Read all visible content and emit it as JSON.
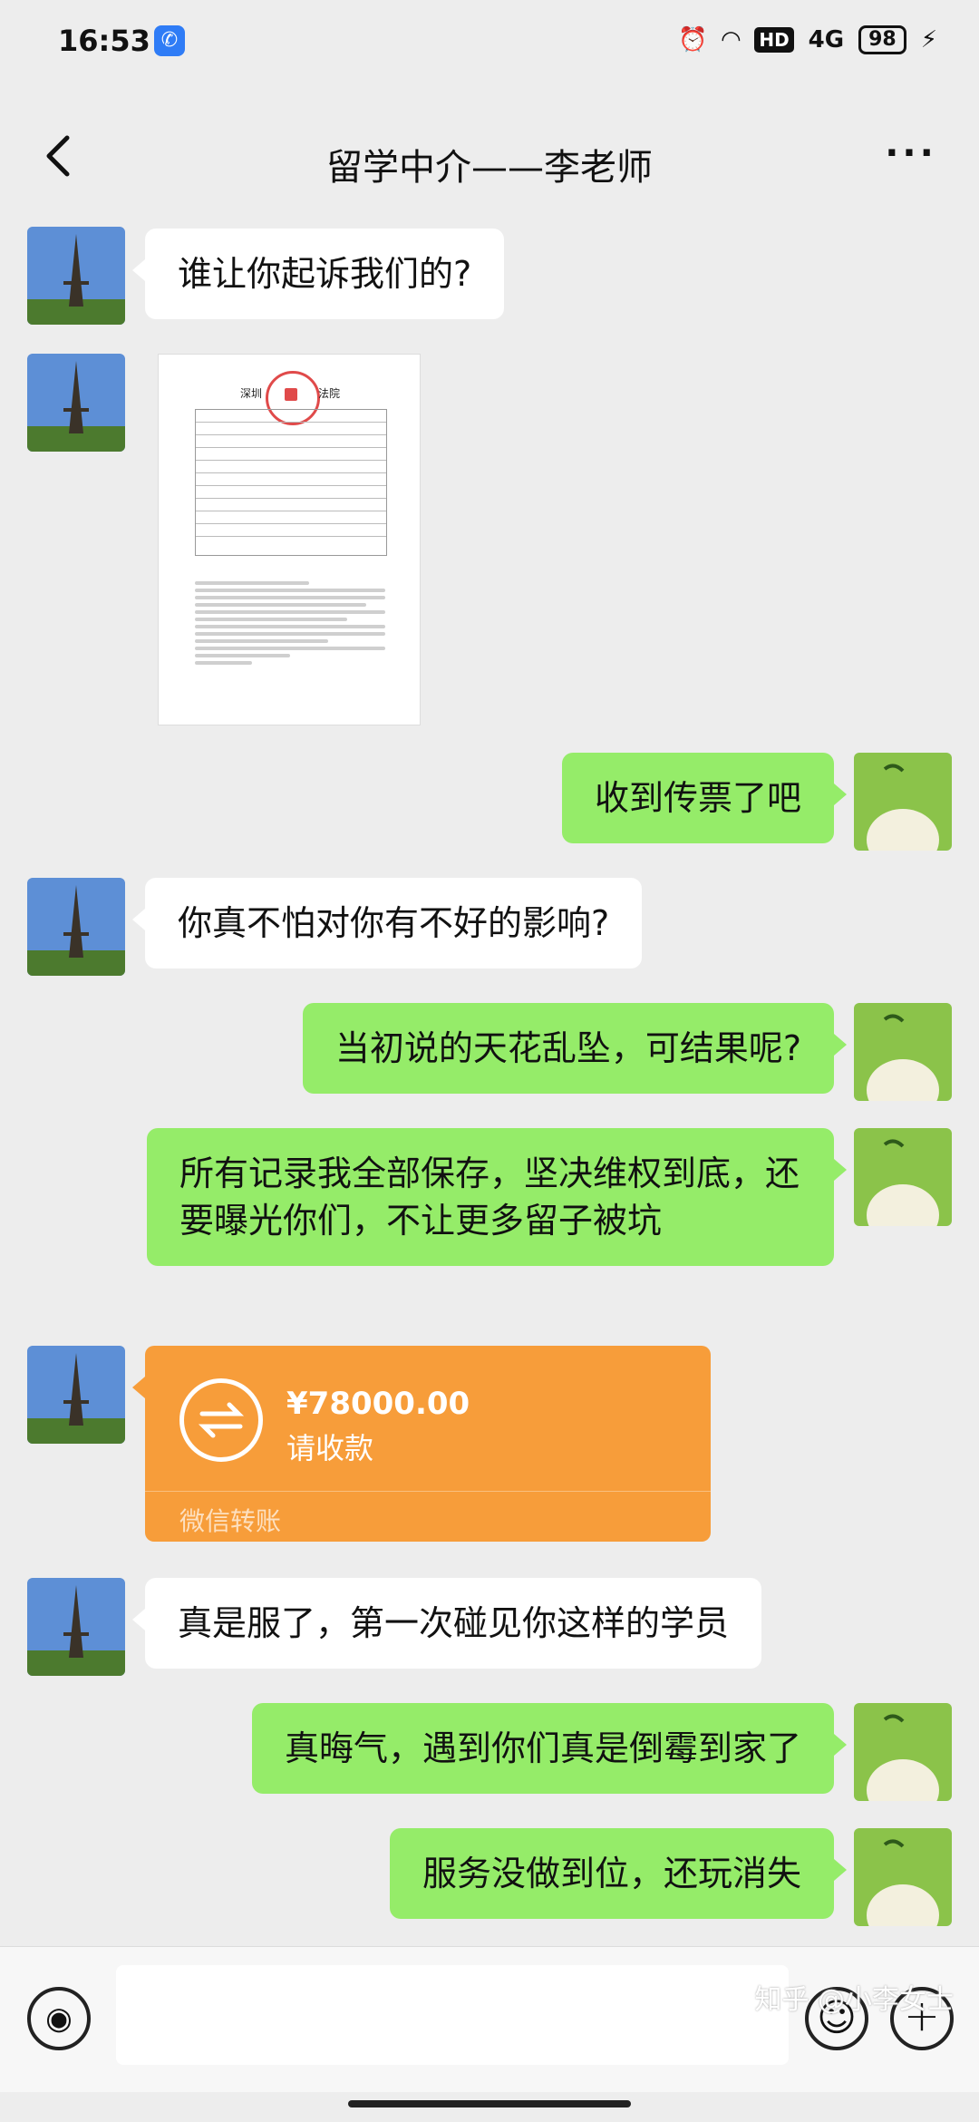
{
  "status_bar": {
    "time": "16:53",
    "network": "4G",
    "battery": "98",
    "hd": "HD"
  },
  "header": {
    "title": "留学中介——李老师",
    "more": "···"
  },
  "messages": [
    {
      "side": "in",
      "text": "谁让你起诉我们的?"
    },
    {
      "side": "in",
      "type": "image",
      "doc_court": "深圳",
      "doc_title": "法院"
    },
    {
      "side": "out",
      "text": "收到传票了吧"
    },
    {
      "side": "in",
      "text": "你真不怕对你有不好的影响?"
    },
    {
      "side": "out",
      "text": "当初说的天花乱坠，可结果呢?"
    },
    {
      "side": "out",
      "text": "所有记录我全部保存，坚决维权到底，还要曝光你们，不让更多留子被坑"
    },
    {
      "side": "in",
      "type": "transfer",
      "amount": "¥78000.00",
      "status": "请收款",
      "footer": "微信转账"
    },
    {
      "side": "in",
      "text": "真是服了，第一次碰见你这样的学员"
    },
    {
      "side": "out",
      "text": "真晦气，遇到你们真是倒霉到家了"
    },
    {
      "side": "out",
      "text": "服务没做到位，还玩消失"
    }
  ],
  "watermark": "知乎 @小李女士",
  "colors": {
    "outgoing_bubble": "#95ec69",
    "incoming_bubble": "#ffffff",
    "transfer_card": "#f79d3a",
    "background": "#ededed"
  }
}
